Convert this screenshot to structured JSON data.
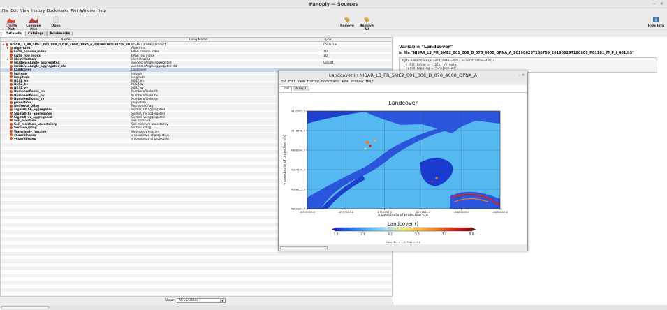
{
  "window": {
    "title": "Panoply — Sources",
    "minimize": "–",
    "close": "×"
  },
  "menu": [
    "File",
    "Edit",
    "View",
    "History",
    "Bookmarks",
    "Plot",
    "Window",
    "Help"
  ],
  "toolbar": {
    "create_plot": "Create Plot",
    "combine_plot": "Combine Plot",
    "open": "Open",
    "remove": "Remove",
    "remove_all": "Remove All",
    "hide_info": "Hide Info"
  },
  "tabs": [
    "Datasets",
    "Catalogs",
    "Bookmarks"
  ],
  "table": {
    "headers": {
      "name": "Name",
      "long_name": "Long Name",
      "type": "Type"
    },
    "rows": [
      {
        "name": "NISAR_L3_PR_SME2_001_008_D_070_4000_QPNA_A_20190829T180759_20...",
        "long": "NISAR L3 SME2 Product",
        "type": "Local File",
        "indent": 0,
        "icon": "file",
        "toggle": "▾"
      },
      {
        "name": "Algorithm",
        "long": "Algorithm",
        "type": "",
        "indent": 1,
        "icon": "group",
        "toggle": "▸"
      },
      {
        "name": "EASE_column_index",
        "long": "EASE column index",
        "type": "1D",
        "indent": 1,
        "icon": "var",
        "toggle": ""
      },
      {
        "name": "EASE_row_index",
        "long": "EASE row index",
        "type": "1D",
        "indent": 1,
        "icon": "var",
        "toggle": ""
      },
      {
        "name": "identification",
        "long": "identification",
        "type": "—",
        "indent": 1,
        "icon": "group",
        "toggle": "▸"
      },
      {
        "name": "incidenceAngle_aggregated",
        "long": "incidenceAngle aggregated",
        "type": "Geo2D",
        "indent": 1,
        "icon": "var",
        "toggle": ""
      },
      {
        "name": "incidenceAngle_aggregated_std",
        "long": "incidenceAngle aggregated std",
        "type": "",
        "indent": 1,
        "icon": "var",
        "toggle": ""
      },
      {
        "name": "Landcover",
        "long": "Landcover",
        "type": "",
        "indent": 1,
        "icon": "var",
        "toggle": "",
        "selected": true
      },
      {
        "name": "latitude",
        "long": "latitude",
        "type": "",
        "indent": 1,
        "icon": "var",
        "toggle": ""
      },
      {
        "name": "longitude",
        "long": "longitude",
        "type": "",
        "indent": 1,
        "icon": "var",
        "toggle": ""
      },
      {
        "name": "NESZ_hh",
        "long": "NESZ hh",
        "type": "",
        "indent": 1,
        "icon": "var",
        "toggle": ""
      },
      {
        "name": "NESZ_hv",
        "long": "NESZ hv",
        "type": "",
        "indent": 1,
        "icon": "var",
        "toggle": ""
      },
      {
        "name": "NESZ_vv",
        "long": "NESZ vv",
        "type": "",
        "indent": 1,
        "icon": "var",
        "toggle": ""
      },
      {
        "name": "Numberoflooks_hh",
        "long": "Numberoflooks hh",
        "type": "",
        "indent": 1,
        "icon": "var",
        "toggle": ""
      },
      {
        "name": "Numberoflooks_hv",
        "long": "Numberoflooks hv",
        "type": "",
        "indent": 1,
        "icon": "var",
        "toggle": ""
      },
      {
        "name": "Numberoflooks_vv",
        "long": "Numberoflooks vv",
        "type": "",
        "indent": 1,
        "icon": "var",
        "toggle": ""
      },
      {
        "name": "projection",
        "long": "projection",
        "type": "",
        "indent": 1,
        "icon": "var",
        "toggle": ""
      },
      {
        "name": "Retrieval_Qflag",
        "long": "Retrieval Qflag",
        "type": "",
        "indent": 1,
        "icon": "var",
        "toggle": ""
      },
      {
        "name": "Sigma0_hh_aggregated",
        "long": "Sigma0 hh aggregated",
        "type": "",
        "indent": 1,
        "icon": "var",
        "toggle": ""
      },
      {
        "name": "Sigma0_hv_aggregated",
        "long": "Sigma0 hv aggregated",
        "type": "",
        "indent": 1,
        "icon": "var",
        "toggle": ""
      },
      {
        "name": "Sigma0_vv_aggregated",
        "long": "Sigma0 vv aggregated",
        "type": "",
        "indent": 1,
        "icon": "var",
        "toggle": ""
      },
      {
        "name": "Soil_moisture",
        "long": "Soil moisture",
        "type": "",
        "indent": 1,
        "icon": "var",
        "toggle": ""
      },
      {
        "name": "Soil_moisture_uncertainty",
        "long": "Soil moisture uncertainty",
        "type": "",
        "indent": 1,
        "icon": "var",
        "toggle": ""
      },
      {
        "name": "Surface_Qflag",
        "long": "Surface Qflag",
        "type": "",
        "indent": 1,
        "icon": "var",
        "toggle": ""
      },
      {
        "name": "Waterbody_fraction",
        "long": "Waterbody fraction",
        "type": "",
        "indent": 1,
        "icon": "var",
        "toggle": ""
      },
      {
        "name": "xCoordinates",
        "long": "x coordinate of projection",
        "type": "",
        "indent": 1,
        "icon": "var",
        "toggle": ""
      },
      {
        "name": "yCoordinates",
        "long": "y coordinate of projection",
        "type": "",
        "indent": 1,
        "icon": "var",
        "toggle": ""
      }
    ]
  },
  "show": {
    "label": "Show:",
    "value": "All variables",
    "arrow": "▾"
  },
  "info": {
    "title": "Variable \"Landcover\"",
    "file": "In file \"NISAR_L3_PR_SME2_001_008_D_070_4000_QPNA_A_20190829T180759_20190829T180809_P01101_M_P_J_001.h5\"",
    "code": "byte Landcover(yCoordinates=405, xCoordinates=450);\n  :_FillValue = -127b; // byte\n  :grid_mapping = \"projection\";"
  },
  "plot_window": {
    "title": "Landcover in NISAR_L3_PR_SME2_001_008_D_070_4000_QPNA_A",
    "menu": [
      "File",
      "Edit",
      "View",
      "History",
      "Bookmarks",
      "Plot",
      "Window",
      "Help"
    ],
    "tabs": [
      "Plot",
      "Array 1"
    ],
    "controls": "–  ×"
  },
  "colors": {
    "ocean": "#1545d6",
    "land": "#4fb6f0",
    "accent": "#d24a2b"
  },
  "chart_data": {
    "type": "heatmap",
    "title": "Landcover",
    "xlabel": "x coordinate of projection (m)",
    "ylabel": "y coordinate of projection (m)",
    "x_ticks": [
      "-8755929.0",
      "-8737913.0",
      "-8719897.0",
      "-8701881.0",
      "-8683865.0",
      "-8665849.0"
    ],
    "y_ticks": [
      "4332973.5",
      "4316758.1",
      "4300544.7",
      "4284330.3",
      "4268115.9",
      "4251901.5"
    ],
    "colorbar": {
      "title": "Landcover ()",
      "ticks": [
        "1.0",
        "2.6",
        "4.2",
        "5.8",
        "7.4",
        "9.0"
      ],
      "min": 1.0,
      "max": 9.0,
      "colors": [
        "#1d2bd8",
        "#2e78f0",
        "#58b7f2",
        "#a8ddf5",
        "#f3ec7a",
        "#f5b941",
        "#ef7a26",
        "#d8221e",
        "#8e0c10"
      ]
    },
    "footer": "Data Min = 1.0, Max = 9.0",
    "grid": true
  }
}
